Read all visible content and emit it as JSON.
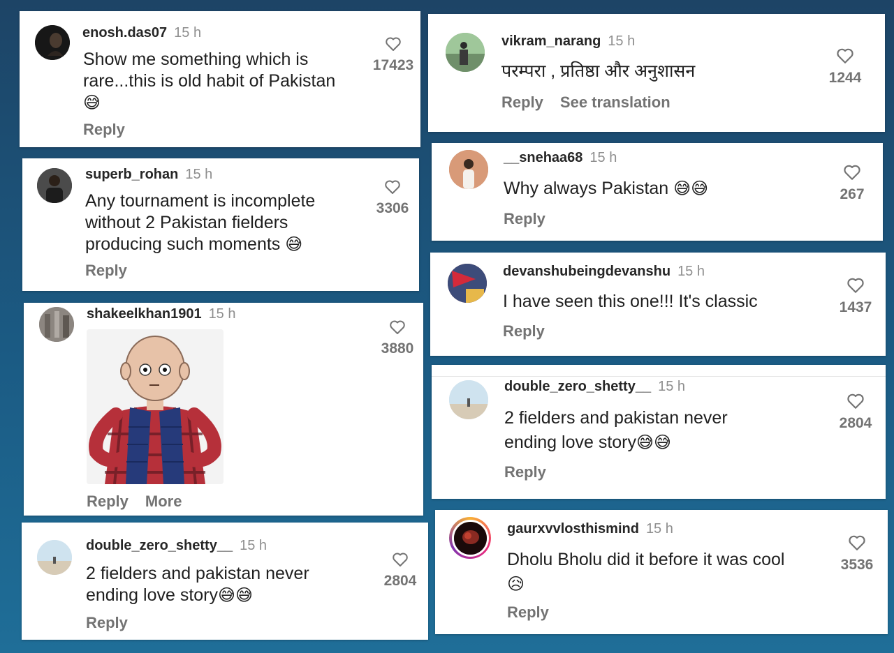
{
  "comments": [
    {
      "username": "enosh.das07",
      "time": "15 h",
      "text": "Show me something which is rare...this is old habit of Pakistan",
      "emoji": "😅",
      "likes": "17423",
      "reply": "Reply"
    },
    {
      "username": "superb_rohan",
      "time": "15 h",
      "text": "Any tournament is incomplete without 2 Pakistan fielders producing such moments",
      "emoji": "😅",
      "likes": "3306",
      "reply": "Reply"
    },
    {
      "username": "shakeelkhan1901",
      "time": "15 h",
      "likes": "3880",
      "reply": "Reply",
      "more": "More"
    },
    {
      "username": "double_zero_shetty__",
      "time": "15 h",
      "text": "2 fielders and pakistan never ending love story",
      "emoji": "😅😅",
      "likes": "2804",
      "reply": "Reply"
    },
    {
      "username": "vikram_narang",
      "time": "15 h",
      "text": "परम्परा , प्रतिष्ठा और अनुशासन",
      "likes": "1244",
      "reply": "Reply",
      "translate": "See translation"
    },
    {
      "username": "__snehaa68",
      "time": "15 h",
      "text": "Why always Pakistan",
      "emoji": "😅😅",
      "likes": "267",
      "reply": "Reply"
    },
    {
      "username": "devanshubeingdevanshu",
      "time": "15 h",
      "text": "I have seen this one!!! It's classic",
      "likes": "1437",
      "reply": "Reply"
    },
    {
      "username": "double_zero_shetty__",
      "time": "15 h",
      "text": "2 fielders and pakistan never ending love story",
      "emoji": "😅😅",
      "likes": "2804",
      "reply": "Reply"
    },
    {
      "username": "gaurxvvlosthismind",
      "time": "15 h",
      "text": "Dholu Bholu did it before it was cool",
      "emoji": "😥",
      "likes": "3536",
      "reply": "Reply"
    }
  ]
}
